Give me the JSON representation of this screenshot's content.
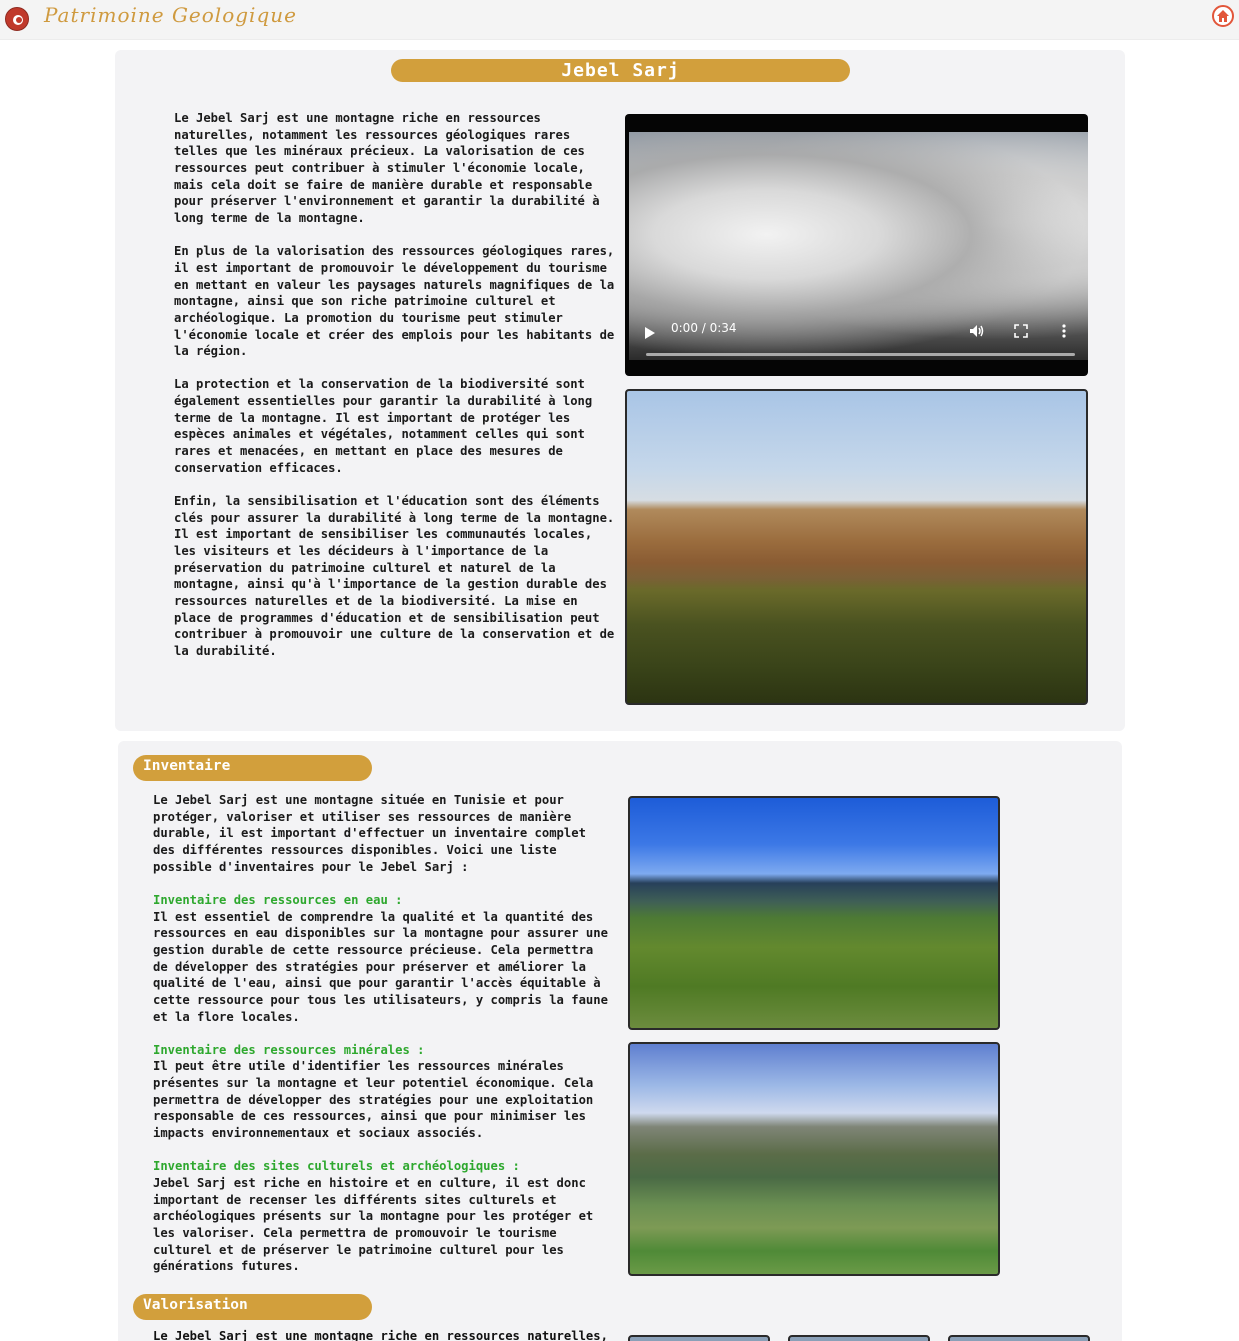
{
  "header": {
    "brand": "Patrimoine Geologique",
    "home_icon": "home-icon",
    "flag_icon": "tunisia-flag-icon",
    "accent_color": "#d29f3c"
  },
  "main": {
    "title": "Jebel Sarj",
    "paragraphs": [
      "Le Jebel Sarj est une montagne riche en ressources naturelles, notamment les ressources géologiques rares telles que les minéraux précieux. La valorisation de ces ressources peut contribuer à stimuler l'économie locale, mais cela doit se faire de manière durable et responsable pour préserver l'environnement et garantir la durabilité à long terme de la montagne.",
      "En plus de la valorisation des ressources géologiques rares, il est important de promouvoir le développement du tourisme en mettant en valeur les paysages naturels magnifiques de la montagne, ainsi que son riche patrimoine culturel et archéologique. La promotion du tourisme peut stimuler l'économie locale et créer des emplois pour les habitants de la région.",
      "La protection et la conservation de la biodiversité sont également essentielles pour garantir la durabilité à long terme de la montagne. Il est important de protéger les espèces animales et végétales, notamment celles qui sont rares et menacées, en mettant en place des mesures de conservation efficaces.",
      "Enfin, la sensibilisation et l'éducation sont des éléments clés pour assurer la durabilité à long terme de la montagne. Il est important de sensibiliser les communautés locales, les visiteurs et les décideurs à l'importance de la préservation du patrimoine culturel et naturel de la montagne, ainsi qu'à l'importance de la gestion durable des ressources naturelles et de la biodiversité. La mise en place de programmes d'éducation et de sensibilisation peut contribuer à promouvoir une culture de la conservation et de la durabilité."
    ],
    "video": {
      "time": "0:00 / 0:34",
      "progress": 0
    }
  },
  "inventaire": {
    "heading": "Inventaire",
    "intro": "Le Jebel Sarj est une montagne située en Tunisie et pour protéger, valoriser et utiliser ses ressources de manière durable, il est important d'effectuer un inventaire complet des différentes ressources disponibles. Voici une liste possible d'inventaires pour le Jebel Sarj :",
    "items": [
      {
        "title": "Inventaire des ressources en eau :",
        "body": "Il est essentiel de comprendre la qualité et la quantité des ressources en eau disponibles sur la montagne pour assurer une gestion durable de cette ressource précieuse. Cela permettra de développer des stratégies pour préserver et améliorer la qualité de l'eau, ainsi que pour garantir l'accès équitable à cette ressource pour tous les utilisateurs, y compris la faune et la flore locales."
      },
      {
        "title": "Inventaire des ressources minérales :",
        "body": "Il peut être utile d'identifier les ressources minérales présentes sur la montagne et leur potentiel économique. Cela permettra de développer des stratégies pour une exploitation responsable de ces ressources, ainsi que pour minimiser les impacts environnementaux et sociaux associés."
      },
      {
        "title": "Inventaire des sites culturels et archéologiques :",
        "body": "Jebel Sarj est riche en histoire et en culture, il est donc important de recenser les différents sites culturels et archéologiques présents sur la montagne pour les protéger et les valoriser. Cela permettra de promouvoir le tourisme culturel et de préserver le patrimoine culturel pour les générations futures."
      }
    ]
  },
  "valorisation": {
    "heading": "Valorisation",
    "intro": "Le Jebel Sarj est une montagne riche en ressources naturelles,"
  }
}
